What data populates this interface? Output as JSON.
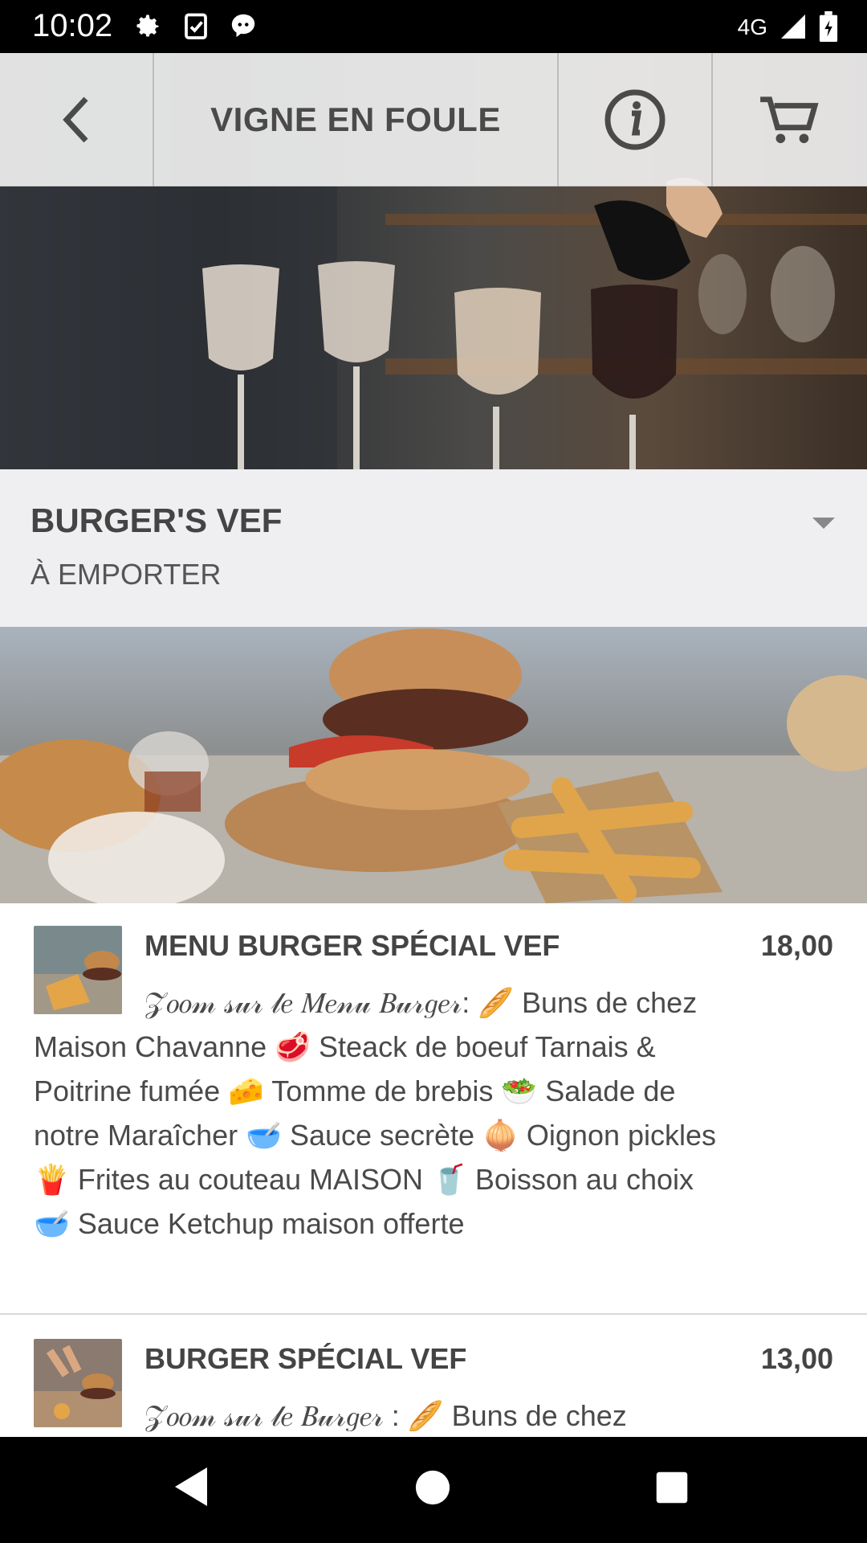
{
  "status_bar": {
    "time": "10:02",
    "network": "4G",
    "left_icons": [
      "gear-icon",
      "clipboard-check-icon",
      "chat-bubble-icon"
    ],
    "right_icons": [
      "signal-icon",
      "battery-icon"
    ]
  },
  "header": {
    "title": "VIGNE EN FOULE",
    "back_icon": "chevron-left-icon",
    "info_icon": "info-icon",
    "cart_icon": "cart-icon"
  },
  "category": {
    "title": "BURGER'S VEF",
    "subtitle": "À EMPORTER",
    "dropdown_icon": "caret-down-icon"
  },
  "items": [
    {
      "name": "MENU BURGER SPÉCIAL VEF",
      "price": "18,00",
      "description": "𝒵𝑜𝑜𝓂 𝓈𝓊𝓇 𝓁𝑒 𝑀𝑒𝓃𝓊 𝐵𝓊𝓇𝑔𝑒𝓇: 🥖 Buns de chez Maison Chavanne 🥩 Steack de boeuf Tarnais & Poitrine fumée 🧀 Tomme de brebis 🥗 Salade de notre Maraîcher 🥣 Sauce secrète 🧅 Oignon pickles 🍟 Frites au couteau MAISON 🥤 Boisson au choix 🥣 Sauce Ketchup maison offerte"
    },
    {
      "name": "BURGER SPÉCIAL VEF",
      "price": "13,00",
      "description": "𝒵𝑜𝑜𝓂 𝓈𝓊𝓇 𝓁𝑒 𝐵𝓊𝓇𝑔𝑒𝓇 : 🥖 Buns de chez"
    }
  ],
  "nav": {
    "back": "triangle-back-icon",
    "home": "circle-home-icon",
    "recents": "square-recents-icon"
  }
}
